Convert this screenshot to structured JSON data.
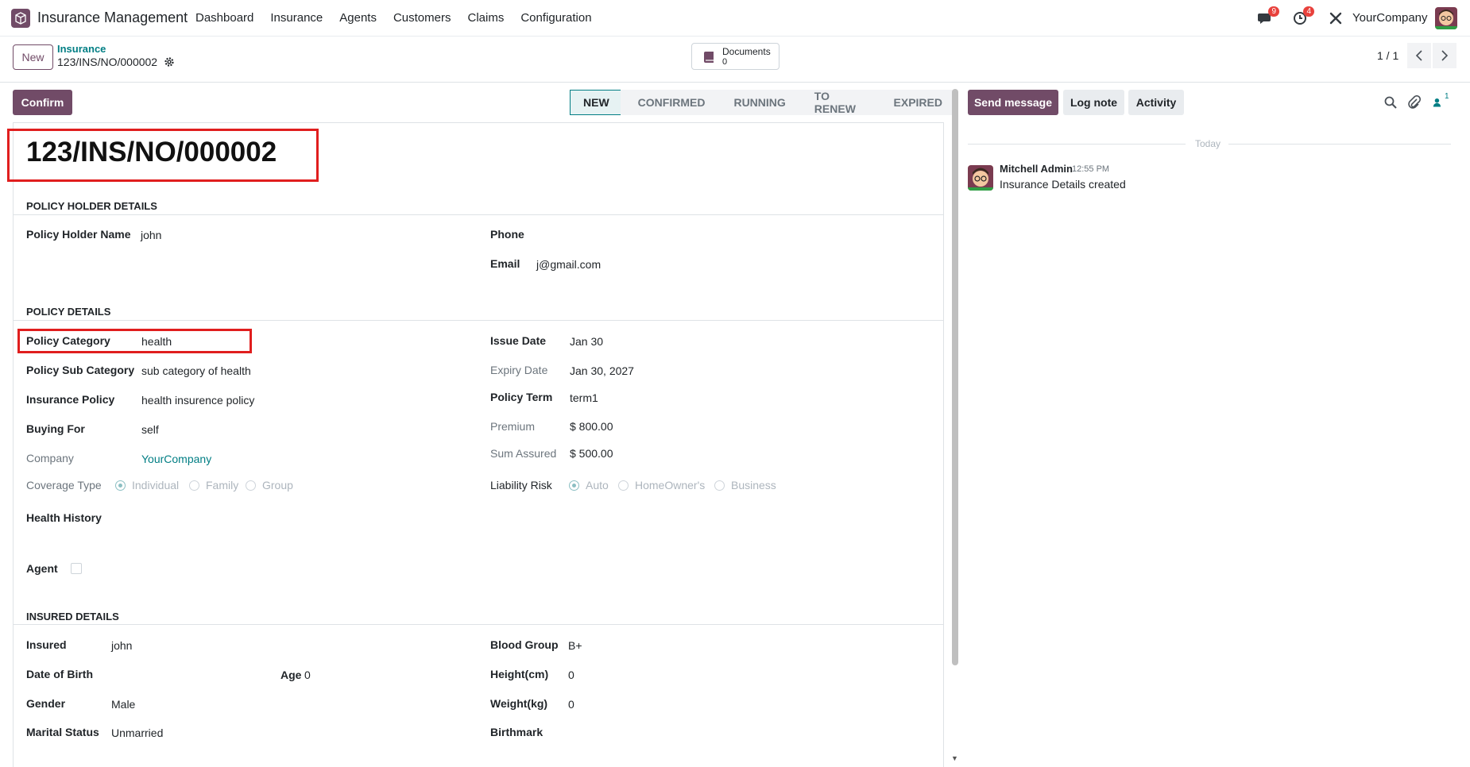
{
  "navbar": {
    "app_name": "Insurance Management",
    "menu": [
      "Dashboard",
      "Insurance",
      "Agents",
      "Customers",
      "Claims",
      "Configuration"
    ],
    "messages_badge": "9",
    "activities_badge": "4",
    "company": "YourCompany"
  },
  "control_panel": {
    "new_label": "New",
    "breadcrumb_parent": "Insurance",
    "breadcrumb_current": "123/INS/NO/000002",
    "documents_label": "Documents",
    "documents_count": "0",
    "pager": "1 / 1"
  },
  "statusbar": {
    "confirm_label": "Confirm",
    "stages": [
      "NEW",
      "CONFIRMED",
      "RUNNING",
      "TO RENEW",
      "EXPIRED"
    ],
    "active_stage": "NEW"
  },
  "form": {
    "title": "123/INS/NO/000002",
    "policy_holder": {
      "section": "POLICY HOLDER DETAILS",
      "name_label": "Policy Holder Name",
      "name_value": "john",
      "phone_label": "Phone",
      "phone_value": "",
      "email_label": "Email",
      "email_value": "j@gmail.com"
    },
    "policy": {
      "section": "POLICY DETAILS",
      "category_label": "Policy Category",
      "category_value": "health",
      "sub_category_label": "Policy Sub Category",
      "sub_category_value": "sub category of health",
      "insurance_policy_label": "Insurance Policy",
      "insurance_policy_value": "health insurence policy",
      "buying_for_label": "Buying For",
      "buying_for_value": "self",
      "company_label": "Company",
      "company_value": "YourCompany",
      "coverage_label": "Coverage Type",
      "coverage_options": [
        "Individual",
        "Family",
        "Group"
      ],
      "coverage_selected": "Individual",
      "health_history_label": "Health History",
      "agent_label": "Agent",
      "issue_date_label": "Issue Date",
      "issue_date_value": "Jan 30",
      "expiry_date_label": "Expiry Date",
      "expiry_date_value": "Jan 30, 2027",
      "term_label": "Policy Term",
      "term_value": "term1",
      "premium_label": "Premium",
      "premium_value": "$ 800.00",
      "sum_assured_label": "Sum Assured",
      "sum_assured_value": "$ 500.00",
      "liability_label": "Liability Risk",
      "liability_options": [
        "Auto",
        "HomeOwner's",
        "Business"
      ],
      "liability_selected": "Auto"
    },
    "insured": {
      "section": "INSURED DETAILS",
      "insured_label": "Insured",
      "insured_value": "john",
      "dob_label": "Date of Birth",
      "dob_value": "",
      "age_label": "Age",
      "age_value": "0",
      "gender_label": "Gender",
      "gender_value": "Male",
      "marital_label": "Marital Status",
      "marital_value": "Unmarried",
      "blood_label": "Blood Group",
      "blood_value": "B+",
      "height_label": "Height(cm)",
      "height_value": "0",
      "weight_label": "Weight(kg)",
      "weight_value": "0",
      "birthmark_label": "Birthmark",
      "birthmark_value": ""
    }
  },
  "chatter": {
    "send_label": "Send message",
    "log_label": "Log note",
    "activity_label": "Activity",
    "followers_count": "1",
    "today_label": "Today",
    "message": {
      "author": "Mitchell Admin",
      "time": "12:55 PM",
      "body": "Insurance Details created"
    }
  },
  "colors": {
    "brand": "#714b67",
    "link": "#017e84",
    "highlight": "#e01e1e"
  }
}
